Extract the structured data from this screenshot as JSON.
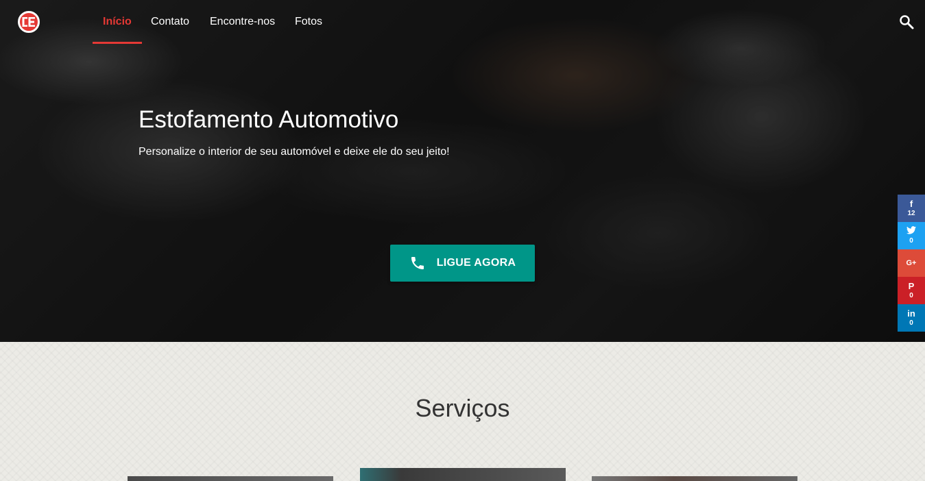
{
  "nav": {
    "logo_text": "CE",
    "items": [
      {
        "label": "Início",
        "active": true
      },
      {
        "label": "Contato",
        "active": false
      },
      {
        "label": "Encontre-nos",
        "active": false
      },
      {
        "label": "Fotos",
        "active": false
      }
    ],
    "search_icon": "search-icon"
  },
  "hero": {
    "title": "Estofamento Automotivo",
    "subtitle": "Personalize o interior de seu automóvel e deixe ele do seu jeito!",
    "cta_label": "LIGUE AGORA",
    "cta_icon": "phone-icon",
    "cta_color": "#009688"
  },
  "share": [
    {
      "network": "facebook",
      "glyph": "f",
      "count": "12",
      "color": "#3b5998"
    },
    {
      "network": "twitter",
      "glyph": "🐦",
      "count": "0",
      "color": "#1da1f2"
    },
    {
      "network": "google-plus",
      "glyph": "G+",
      "count": "",
      "color": "#dd4b39"
    },
    {
      "network": "pinterest",
      "glyph": "P",
      "count": "0",
      "color": "#cb2027"
    },
    {
      "network": "linkedin",
      "glyph": "in",
      "count": "0",
      "color": "#0077b5"
    }
  ],
  "services": {
    "title": "Serviços"
  },
  "colors": {
    "accent": "#e53935",
    "teal": "#009688"
  }
}
